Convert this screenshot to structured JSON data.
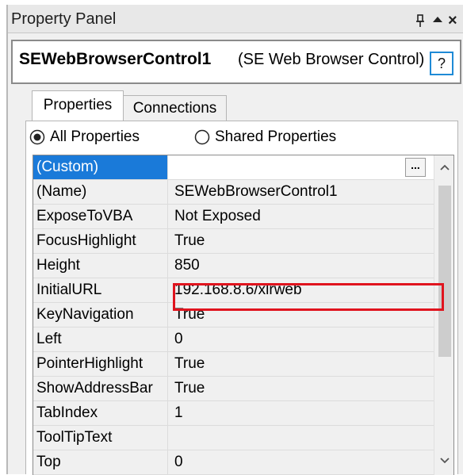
{
  "panel": {
    "title": "Property Panel",
    "icons": {
      "pin": "pin-icon",
      "up": "chevron-up-icon",
      "close": "close-icon"
    },
    "close_glyph": "×"
  },
  "object": {
    "name": "SEWebBrowserControl1",
    "type": "(SE Web Browser Control)",
    "help_label": "?"
  },
  "tabs": [
    {
      "label": "Properties",
      "active": true
    },
    {
      "label": "Connections",
      "active": false
    }
  ],
  "filter": {
    "all_label": "All Properties",
    "shared_label": "Shared Properties",
    "selected": "all"
  },
  "grid": {
    "ellipsis_label": "...",
    "rows": [
      {
        "name": "(Custom)",
        "value": "",
        "selected": true
      },
      {
        "name": "(Name)",
        "value": "SEWebBrowserControl1"
      },
      {
        "name": "ExposeToVBA",
        "value": "Not Exposed"
      },
      {
        "name": "FocusHighlight",
        "value": "True"
      },
      {
        "name": "Height",
        "value": "850"
      },
      {
        "name": "InitialURL",
        "value": "192.168.8.6/xlrweb",
        "highlighted": true
      },
      {
        "name": "KeyNavigation",
        "value": "True"
      },
      {
        "name": "Left",
        "value": "0"
      },
      {
        "name": "PointerHighlight",
        "value": "True"
      },
      {
        "name": "ShowAddressBar",
        "value": "True"
      },
      {
        "name": "TabIndex",
        "value": "1"
      },
      {
        "name": "ToolTipText",
        "value": ""
      },
      {
        "name": "Top",
        "value": "0"
      }
    ]
  },
  "colors": {
    "selection": "#1a7ad9",
    "highlight_border": "#e0141e",
    "help_border": "#1f8ad6"
  }
}
